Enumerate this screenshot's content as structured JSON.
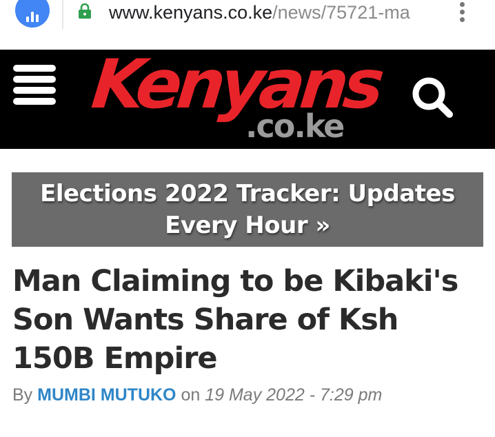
{
  "browser": {
    "url_domain": "www.kenyans.co.ke",
    "url_path": "/news/75721-ma",
    "icons": {
      "site_info": "analytics-icon",
      "secure": "lock-icon",
      "menu": "more-vert-icon"
    },
    "colors": {
      "site_info_bg": "#4285f4",
      "lock": "#2e9e4f"
    }
  },
  "site_header": {
    "logo_text": "Kenyans",
    "logo_domain": ".co.ke",
    "menu_icon": "hamburger-icon",
    "search_icon": "search-icon",
    "colors": {
      "background": "#000000",
      "logo_red": "#e8242a",
      "logo_grey": "#9b9b9b"
    }
  },
  "tracker_banner": {
    "text": "Elections 2022 Tracker: Updates Every Hour »",
    "colors": {
      "background": "#6b6b6b",
      "text": "#ffffff"
    }
  },
  "article": {
    "headline": "Man Claiming to be Kibaki's Son Wants Share of Ksh 150B Empire",
    "byline_prefix": "By",
    "author": "MUMBI MUTUKO",
    "byline_on": "on",
    "date": "19 May 2022 - 7:29 pm",
    "colors": {
      "headline": "#2b2b2b",
      "author_link": "#2f86c8"
    }
  }
}
